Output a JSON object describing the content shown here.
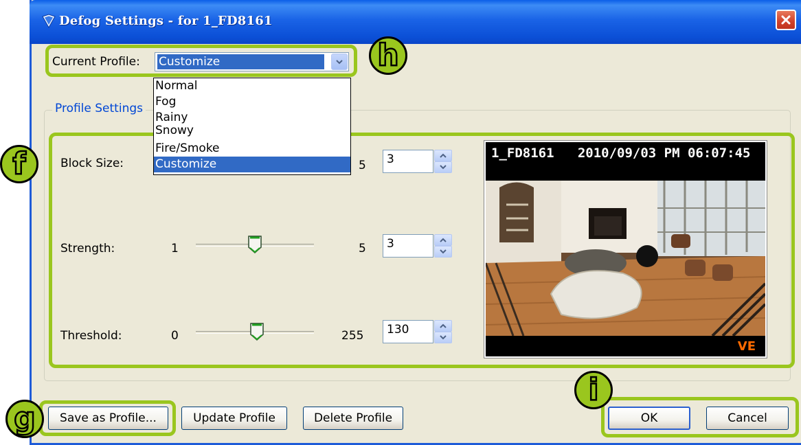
{
  "window": {
    "title": "Defog Settings - for 1_FD8161"
  },
  "profile": {
    "label": "Current Profile:",
    "selected": "Customize",
    "options": [
      "Normal",
      "Fog",
      "Rainy",
      "Snowy",
      "Fire/Smoke",
      "Customize"
    ]
  },
  "group": {
    "title": "Profile Settings"
  },
  "settings": {
    "block_size": {
      "label": "Block Size:",
      "max": "5",
      "value": "3"
    },
    "strength": {
      "label": "Strength:",
      "min": "1",
      "max": "5",
      "value": "3",
      "level": 0.5
    },
    "threshold": {
      "label": "Threshold:",
      "min": "0",
      "max": "255",
      "value": "130",
      "level": 0.51
    }
  },
  "preview": {
    "camera": "1_FD8161",
    "timestamp": "2010/09/03 PM 06:07:45",
    "tag": "VE"
  },
  "buttons": {
    "save_as_profile": "Save as Profile...",
    "update_profile": "Update Profile",
    "delete_profile": "Delete Profile",
    "ok": "OK",
    "cancel": "Cancel"
  },
  "badges": {
    "h": "h",
    "f": "f",
    "g": "g",
    "i": "i"
  },
  "colors": {
    "highlight": "#9ac61e",
    "title_bar": "#0b4fd6",
    "selection": "#316ac5"
  }
}
